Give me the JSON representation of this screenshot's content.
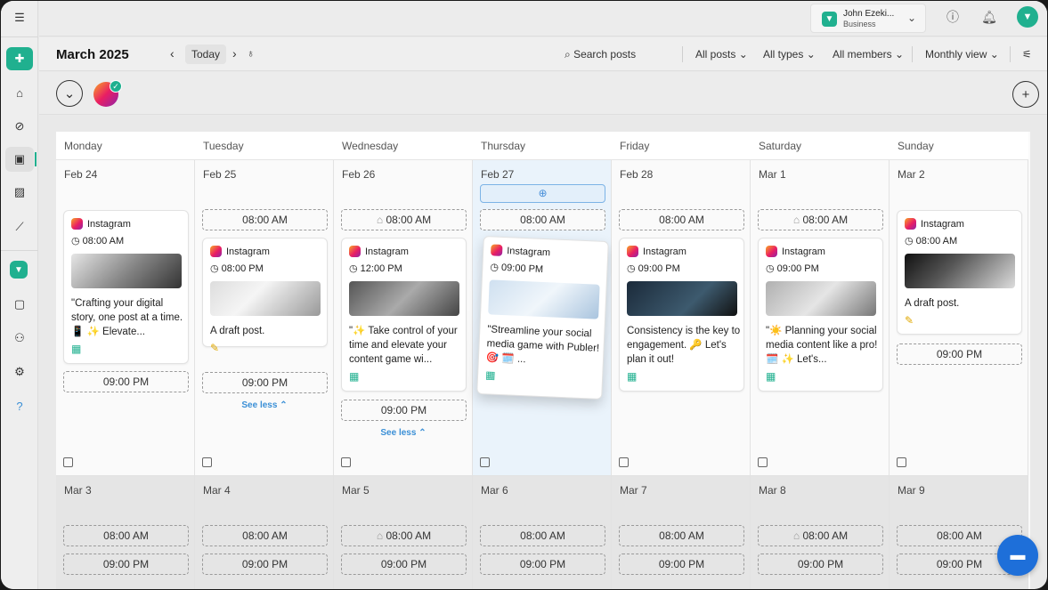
{
  "header": {
    "workspace_name": "John Ezeki...",
    "workspace_plan": "Business"
  },
  "toolbar": {
    "month": "March 2025",
    "today": "Today",
    "search": "Search posts",
    "filters": [
      "All posts",
      "All types",
      "All members",
      "Monthly view"
    ]
  },
  "days_of_week": [
    "Monday",
    "Tuesday",
    "Wednesday",
    "Thursday",
    "Friday",
    "Saturday",
    "Sunday"
  ],
  "week1": {
    "dates": [
      "Feb 24",
      "Feb 25",
      "Feb 26",
      "Feb 27",
      "Feb 28",
      "Mar 1",
      "Mar 2"
    ],
    "top_slots": [
      "",
      "08:00 AM",
      "08:00 AM",
      "08:00 AM",
      "08:00 AM",
      "08:00 AM",
      ""
    ],
    "posts": [
      {
        "network": "Instagram",
        "time": "08:00 AM",
        "text": "\"Crafting your digital story, one post at a time. 📱 ✨ Elevate...",
        "status": "scheduled"
      },
      {
        "network": "Instagram",
        "time": "08:00 PM",
        "text": "A draft post.",
        "status": "draft"
      },
      {
        "network": "Instagram",
        "time": "12:00 PM",
        "text": "\"✨ Take control of your time and elevate your content game wi...",
        "status": "scheduled"
      },
      {
        "network": "Instagram",
        "time": "09:00 PM",
        "text": "\"Streamline your social media game with Publer! 🎯 🗓️ ...",
        "status": "scheduled"
      },
      {
        "network": "Instagram",
        "time": "09:00 PM",
        "text": "Consistency is the key to engagement. 🔑 Let's plan it out!",
        "status": "scheduled"
      },
      {
        "network": "Instagram",
        "time": "09:00 PM",
        "text": "\"☀️ Planning your social media content like a pro! 🗓️ ✨ Let's...",
        "status": "scheduled"
      },
      {
        "network": "Instagram",
        "time": "08:00 AM",
        "text": "A draft post.",
        "status": "draft"
      }
    ],
    "bottom_slots": [
      "09:00 PM",
      "09:00 PM",
      "09:00 PM",
      "",
      "",
      "",
      "09:00 PM"
    ],
    "see_less": "See less"
  },
  "week2": {
    "dates": [
      "Mar 3",
      "Mar 4",
      "Mar 5",
      "Mar 6",
      "Mar 7",
      "Mar 8",
      "Mar 9"
    ],
    "am": "08:00 AM",
    "pm": "09:00 PM"
  },
  "colors": {
    "brand": "#20b08f",
    "link": "#3a8fd6",
    "chat": "#1e6fd9"
  }
}
